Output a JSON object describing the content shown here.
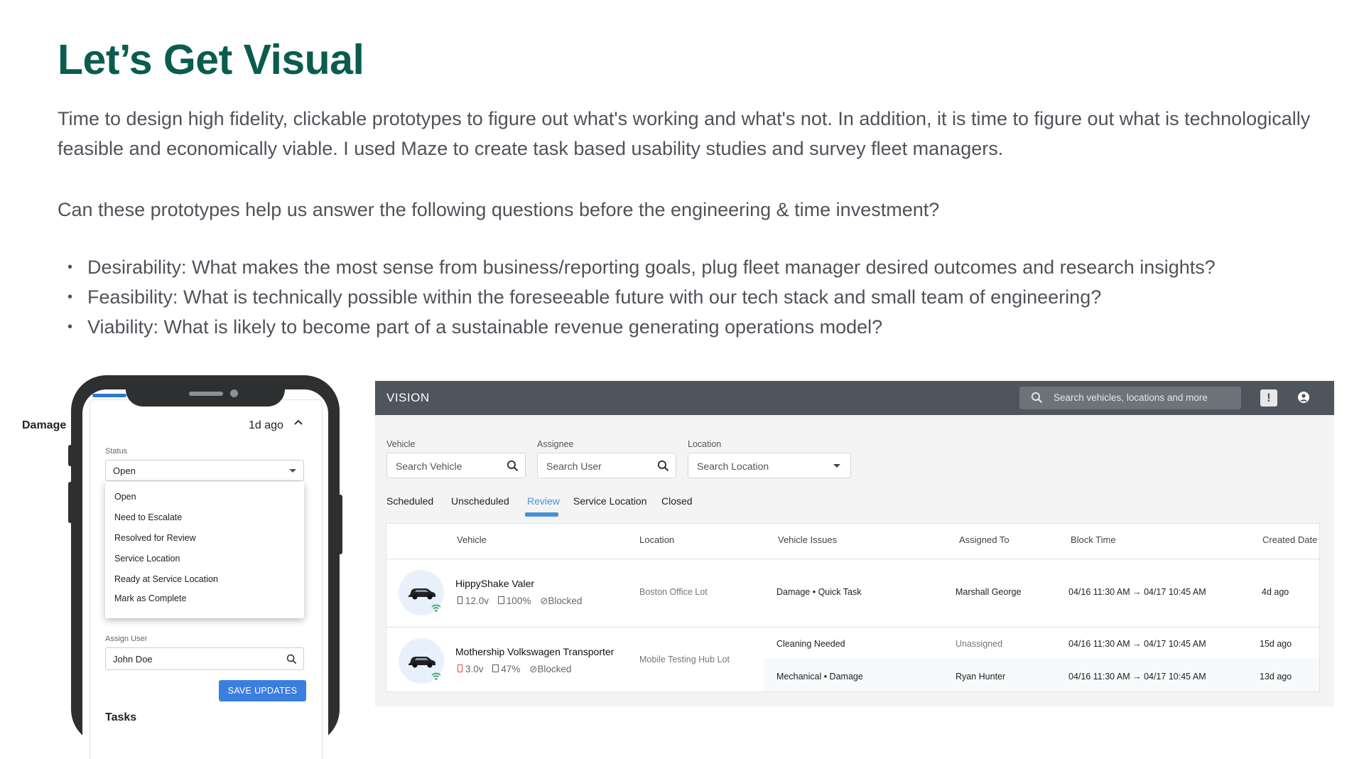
{
  "page": {
    "title": "Let’s Get Visual",
    "paragraph1": "Time to design high fidelity, clickable prototypes to figure out what's working and what's not. In addition, it is time to figure out what is technologically feasible and economically viable. I used Maze to create task based usability studies and survey fleet managers.",
    "paragraph2": "Can these prototypes help us answer the following questions before the engineering & time investment?",
    "bullets": [
      "Desirability: What makes the most sense from business/reporting goals, plug fleet manager desired outcomes and research insights?",
      "Feasibility: What is technically possible within the foreseeable future with our tech stack and small team of engineering?",
      "Viability: What is likely to become part of a sustainable revenue generating operations model?"
    ]
  },
  "phone": {
    "section_title": "Damage",
    "time_ago": "1d ago",
    "status_label": "Status",
    "status_value": "Open",
    "status_options": [
      "Open",
      "Need to Escalate",
      "Resolved for Review",
      "Service Location",
      "Ready at Service Location",
      "Mark as Complete"
    ],
    "assign_label": "Assign User",
    "assign_value": "John Doe",
    "save_label": "SAVE UPDATES",
    "tasks_label": "Tasks"
  },
  "dashboard": {
    "app_name": "VISION",
    "search_placeholder": "Search vehicles, locations and more",
    "alert_glyph": "!",
    "filters": {
      "vehicle_label": "Vehicle",
      "vehicle_placeholder": "Search Vehicle",
      "assignee_label": "Assignee",
      "assignee_placeholder": "Search User",
      "location_label": "Location",
      "location_placeholder": "Search Location"
    },
    "tabs": [
      "Scheduled",
      "Unscheduled",
      "Review",
      "Service Location",
      "Closed"
    ],
    "active_tab": "Review",
    "columns": [
      "Vehicle",
      "Location",
      "Vehicle Issues",
      "Assigned To",
      "Block Time",
      "Created Date"
    ],
    "rows": [
      {
        "vehicle": "HippyShake Valer",
        "battery": "12.0v",
        "fuel": "100%",
        "state": "Blocked",
        "location": "Boston Office Lot",
        "issues": [
          {
            "issue": "Damage • Quick Task",
            "assigned": "Marshall George",
            "block_time": "04/16 11:30 AM → 04/17 10:45 AM",
            "created": "4d ago"
          }
        ]
      },
      {
        "vehicle": "Mothership Volkswagen Transporter",
        "battery": "3.0v",
        "fuel": "47%",
        "state": "Blocked",
        "location": "Mobile Testing Hub Lot",
        "issues": [
          {
            "issue": "Cleaning Needed",
            "assigned": "Unassigned",
            "block_time": "04/16 11:30 AM → 04/17 10:45 AM",
            "created": "15d ago"
          },
          {
            "issue": "Mechanical • Damage",
            "assigned": "Ryan Hunter",
            "block_time": "04/16 11:30 AM → 04/17 10:45 AM",
            "created": "13d ago"
          }
        ]
      }
    ]
  },
  "colors": {
    "title": "#0a5c4f",
    "body_text": "#4f5359",
    "accent_blue": "#4a90d9",
    "topbar": "#4e555c",
    "signal_green": "#3aa55a",
    "battery_low": "#e0463a"
  }
}
